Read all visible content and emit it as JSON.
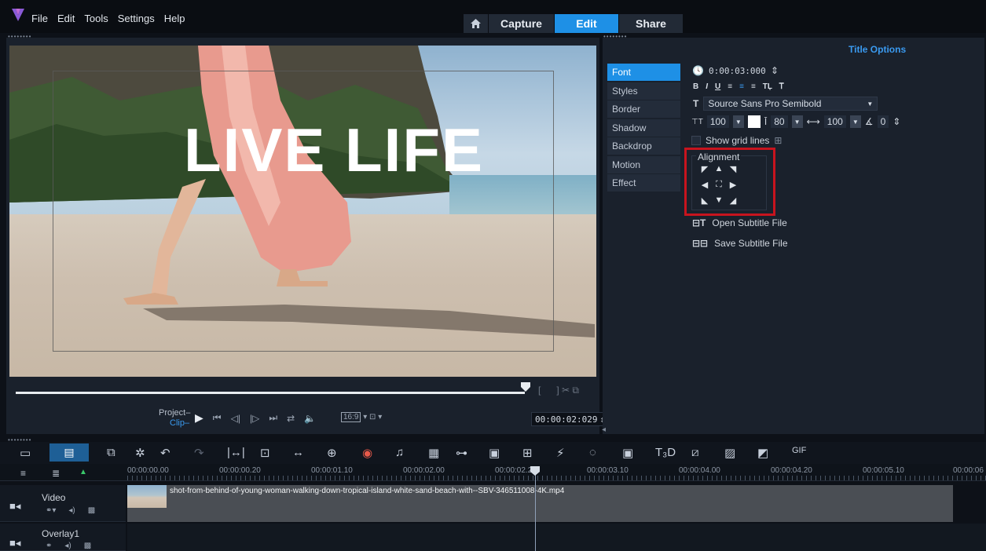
{
  "menu": {
    "items": [
      "File",
      "Edit",
      "Tools",
      "Settings",
      "Help"
    ]
  },
  "workspace_tabs": {
    "home_icon": "home-icon",
    "capture": "Capture",
    "edit": "Edit",
    "share": "Share",
    "active": "Edit"
  },
  "preview": {
    "title_text": "LIVE LIFE",
    "mode_project": "Project",
    "mode_clip": "Clip",
    "aspect": "16:9",
    "timecode": "00:00:02:029"
  },
  "options": {
    "header": "Title Options",
    "side_tabs": [
      "Font",
      "Styles",
      "Border",
      "Shadow",
      "Backdrop",
      "Motion",
      "Effect"
    ],
    "active_tab": "Font",
    "duration": "0:00:03:000",
    "font_name": "Source Sans Pro Semibold",
    "font_size": "100",
    "line_spacing": "80",
    "char_spacing": "100",
    "rotation": "0",
    "show_grid_lines": "Show grid lines",
    "alignment_label": "Alignment",
    "open_subtitle": "Open Subtitle File",
    "save_subtitle": "Save Subtitle File"
  },
  "timeline": {
    "ruler": [
      "00:00:00.00",
      "00:00:00.20",
      "00:00:01.10",
      "00:00:02.00",
      "00:00:02.20",
      "00:00:03.10",
      "00:00:04.00",
      "00:00:04.20",
      "00:00:05.10",
      "00:00:06"
    ],
    "tracks": {
      "video": "Video",
      "overlay": "Overlay1"
    },
    "clip_name": "shot-from-behind-of-young-woman-walking-down-tropical-island-white-sand-beach-with--SBV-346511008-4K.mp4"
  },
  "colors": {
    "accent": "#1e90e6",
    "highlight_box": "#c8141e"
  }
}
